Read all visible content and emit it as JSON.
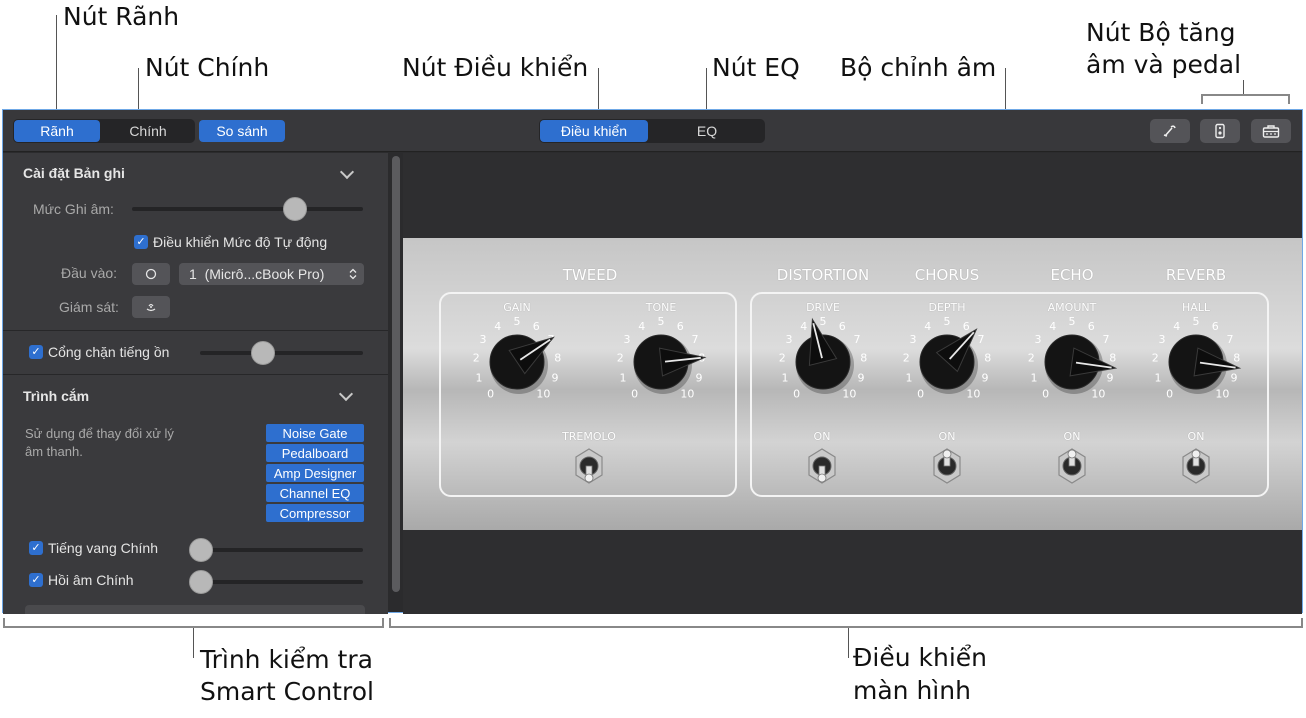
{
  "callouts": {
    "track_button": "Nút Rãnh",
    "master_button": "Nút Chính",
    "controls_button": "Nút Điều khiển",
    "eq_button": "Nút EQ",
    "tuner": "Bộ chỉnh âm",
    "stompbox_line1": "Nút Bộ tăng",
    "stompbox_line2": "âm và pedal",
    "inspector_line1": "Trình kiểm tra",
    "inspector_line2": "Smart Control",
    "screen_line1": "Điều khiển",
    "screen_line2": "màn hình"
  },
  "toolbar": {
    "track": "Rãnh",
    "master": "Chính",
    "compare": "So sánh",
    "controls": "Điều khiển",
    "eq": "EQ",
    "icons": [
      "tuner-icon",
      "pedalboard-icon",
      "amp-icon"
    ]
  },
  "inspector": {
    "recording_settings": {
      "title": "Cài đặt Bản ghi",
      "record_level_label": "Mức Ghi âm:",
      "record_level": 0.73,
      "auto_level_label": "Điều khiển Mức độ Tự động",
      "auto_level_checked": true,
      "input_label": "Đầu vào:",
      "input_value": "1  (Micrô...cBook Pro)",
      "monitor_label": "Giám sát:"
    },
    "noise_gate": {
      "label": "Cổng chặn tiếng ồn",
      "checked": true,
      "level": 0.37
    },
    "plugins": {
      "title": "Trình cắm",
      "description_line1": "Sử dụng để thay đổi xử lý",
      "description_line2": "âm thanh.",
      "items": [
        "Noise Gate",
        "Pedalboard",
        "Amp Designer",
        "Channel EQ",
        "Compressor"
      ]
    },
    "master_reverb": {
      "label": "Tiếng vang Chính",
      "checked": true,
      "level": 0.0
    },
    "master_echo": {
      "label": "Hồi âm Chính",
      "checked": true,
      "level": 0.0
    }
  },
  "amp": {
    "tweed": {
      "title": "TWEED",
      "gain": {
        "label": "GAIN",
        "value": 7
      },
      "tone": {
        "label": "TONE",
        "value": 8
      },
      "tremolo": "TREMOLO"
    },
    "distortion": {
      "title": "DISTORTION",
      "label": "DRIVE",
      "value": 4.5,
      "switch": "ON"
    },
    "chorus": {
      "title": "CHORUS",
      "label": "DEPTH",
      "value": 6.5,
      "switch": "ON"
    },
    "echo": {
      "title": "ECHO",
      "label": "AMOUNT",
      "value": 8.5,
      "switch": "ON"
    },
    "reverb": {
      "title": "REVERB",
      "label": "HALL",
      "value": 8.5,
      "switch": "ON"
    },
    "tick_labels": [
      "0",
      "1",
      "2",
      "3",
      "4",
      "5",
      "6",
      "7",
      "8",
      "9",
      "10"
    ]
  }
}
